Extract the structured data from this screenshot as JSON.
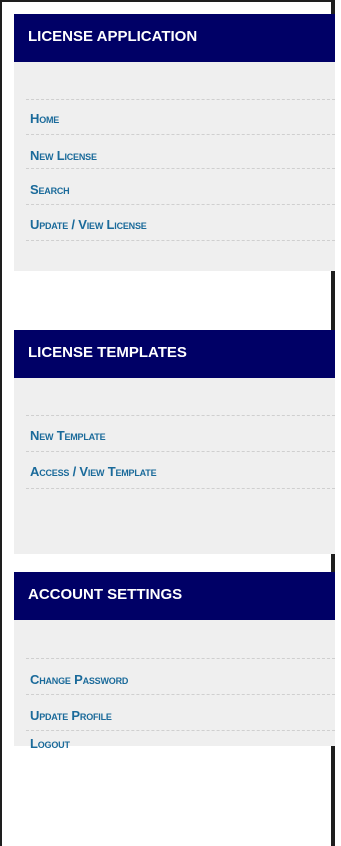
{
  "sections": [
    {
      "title": "LICENSE APPLICATION",
      "links": [
        "Home",
        "New License",
        "Search",
        "Update / View License"
      ]
    },
    {
      "title": "LICENSE TEMPLATES",
      "links": [
        "New Template",
        "Access / View Template"
      ]
    },
    {
      "title": "ACCOUNT SETTINGS",
      "links": [
        "Change Password",
        "Update Profile",
        "Logout"
      ]
    }
  ],
  "colors": {
    "header_background": "#000066",
    "header_text": "#ffffff",
    "link_text": "#1a6a9a",
    "panel_background": "#efefef"
  }
}
